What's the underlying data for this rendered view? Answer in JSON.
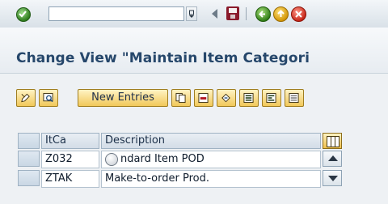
{
  "toolbar": {
    "command_field_value": "",
    "icons": [
      "ok-icon",
      "dropdown-icon",
      "back-arrow-icon",
      "save-icon",
      "back-icon",
      "exit-icon",
      "cancel-icon"
    ]
  },
  "title_bar": {
    "title": "Change View \"Maintain Item Categori"
  },
  "app_toolbar": {
    "new_entries_label": "New Entries",
    "icons": [
      "edit-pencil-icon",
      "display-icon",
      "copy-icon",
      "delete-icon",
      "undo-icon",
      "select-all-icon",
      "select-block-icon",
      "deselect-all-icon"
    ]
  },
  "table": {
    "columns": [
      "ItCa",
      "Description"
    ],
    "rows": [
      {
        "itca": "Z032",
        "description": "ndard Item POD"
      },
      {
        "itca": "ZTAK",
        "description": "Make-to-order Prod."
      }
    ]
  },
  "colors": {
    "title_text": "#26476b",
    "button_fill": "#f1c85a",
    "header_fill": "#d3dde7",
    "background": "#eef1f4"
  }
}
